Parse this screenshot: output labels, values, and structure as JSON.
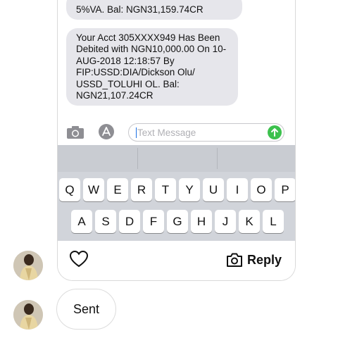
{
  "messages": [
    {
      "text": "5%VA. Bal: NGN31,159.74CR"
    },
    {
      "text": "Your Acct 305XXXX949 Has Been\nDebited with NGN10,000.00 On 10-\nAUG-2018 12:18:57 By\nFIP:USSD:DIA/Dickson  Olu/\nUSSD_TOLUHI OL. Bal:\nNGN21,107.24CR"
    }
  ],
  "composer": {
    "placeholder": "Text Message",
    "camera_icon": "camera-icon",
    "appstore_icon": "app-store-icon",
    "send_icon": "send-arrow-icon",
    "send_color": "#3cc14d"
  },
  "keyboard": {
    "row1": [
      "Q",
      "W",
      "E",
      "R",
      "T",
      "Y",
      "U",
      "I",
      "O",
      "P"
    ],
    "row2": [
      "A",
      "S",
      "D",
      "F",
      "G",
      "H",
      "J",
      "K",
      "L"
    ]
  },
  "story_actions": {
    "like_icon": "heart-icon",
    "reply_icon": "camera-outline-icon",
    "reply_label": "Reply"
  },
  "thread": {
    "sent_label": "Sent"
  }
}
